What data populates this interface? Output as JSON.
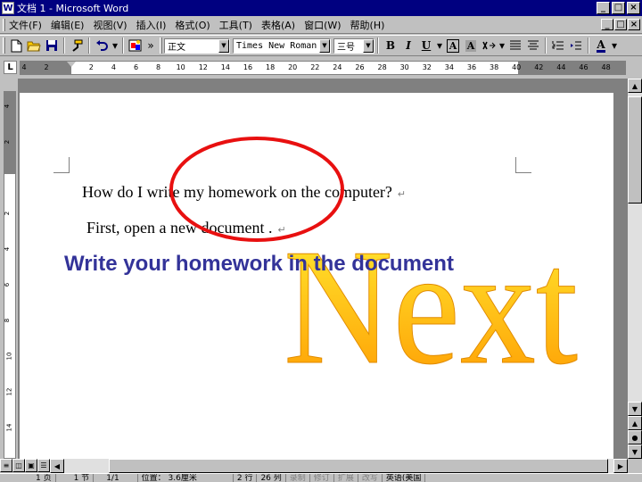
{
  "window": {
    "title": "文档 1 - Microsoft Word",
    "app_icon": "W",
    "minimize": "_",
    "maximize": "□",
    "close": "×"
  },
  "menu": {
    "items": [
      "文件(F)",
      "编辑(E)",
      "视图(V)",
      "插入(I)",
      "格式(O)",
      "工具(T)",
      "表格(A)",
      "窗口(W)",
      "帮助(H)"
    ]
  },
  "toolbar": {
    "style": "正文",
    "font": "Times New Roman",
    "size": "三号",
    "bold": "B",
    "italic": "I",
    "underline": "U",
    "char_border": "A",
    "char_shading": "A",
    "font_color": "A"
  },
  "ruler": {
    "tab_selector": "L",
    "ticks": [
      "4",
      "2",
      "",
      "2",
      "4",
      "6",
      "8",
      "10",
      "12",
      "14",
      "16",
      "18",
      "20",
      "22",
      "24",
      "26",
      "28",
      "30",
      "32",
      "34",
      "36",
      "38",
      "40",
      "42",
      "44",
      "46",
      "48"
    ],
    "vticks": [
      "4",
      "2",
      "",
      "2",
      "4",
      "6",
      "8",
      "10",
      "12",
      "14"
    ]
  },
  "document": {
    "line1": "How do I write my homework on the computer?",
    "line2": "First, open a new document .",
    "paragraph_mark": "↵",
    "caption": "Write your homework in the document",
    "wordart": "Next",
    "caption_color": "#333399",
    "circle_color": "#e81010",
    "wordart_colors": [
      "#ffee33",
      "#ff9900"
    ]
  },
  "statusbar": {
    "page": "1 页",
    "section": "1 节",
    "page_of": "1/1",
    "position": "位置： 3.6厘米",
    "line": "2 行",
    "column": "26 列",
    "rec": "录制",
    "trk": "修订",
    "ext": "扩展",
    "ovr": "改写",
    "language": "英语(美国"
  }
}
